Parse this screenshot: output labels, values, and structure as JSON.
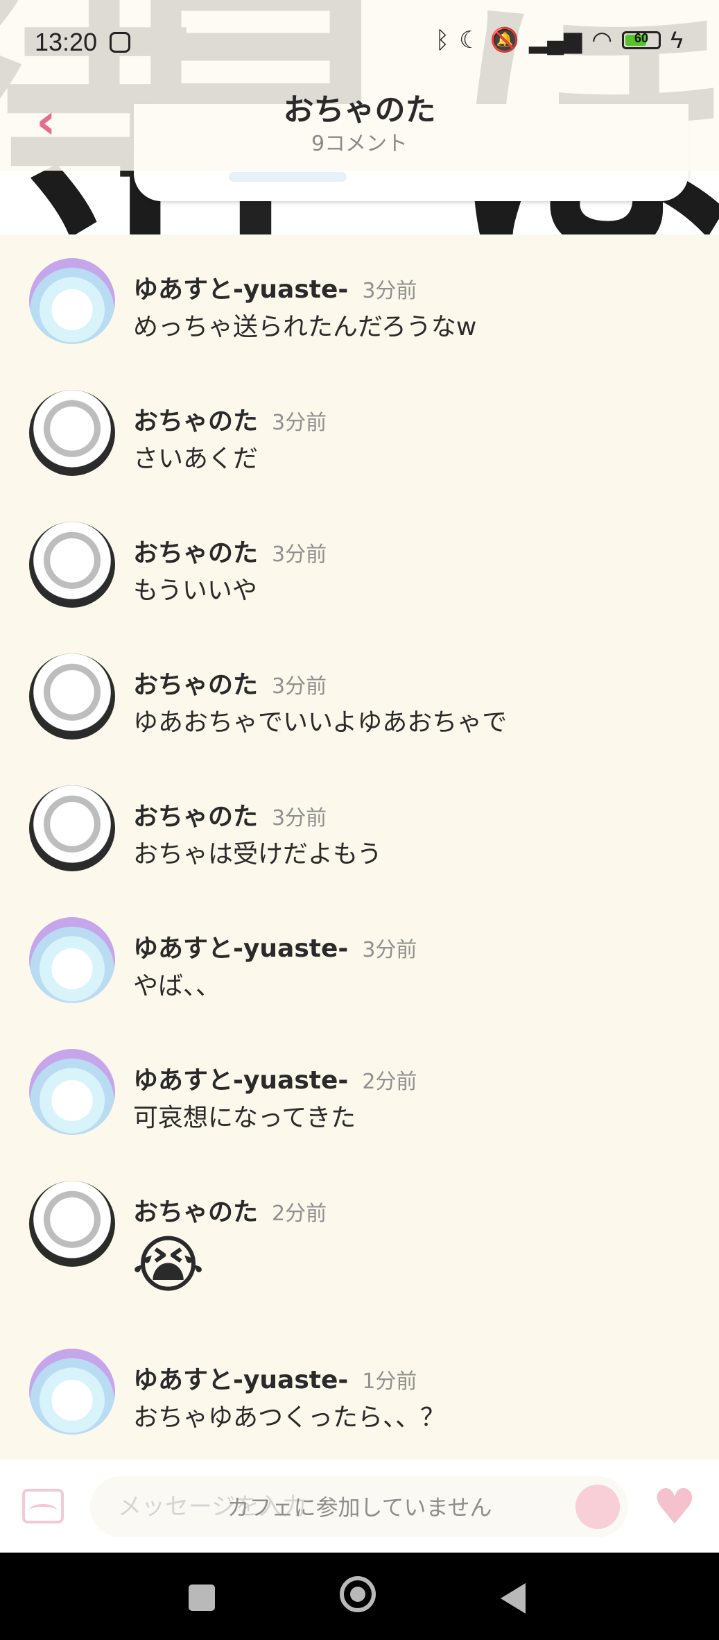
{
  "status_bar": {
    "time": "13:20",
    "left_icon": "mi-icon",
    "right_icons": [
      "bluetooth-icon",
      "moon-icon",
      "mute-icon",
      "signal-icon",
      "wifi-icon",
      "battery-icon",
      "charging-icon"
    ],
    "battery_level": "60",
    "battery_percent": 60
  },
  "header": {
    "title": "おちゃのた",
    "subtitle": "9コメント",
    "back_icon": "chevron-left-icon",
    "accent_color": "#e86a8e"
  },
  "banner": {
    "chars": [
      "待",
      "早",
      "ほ"
    ]
  },
  "comments": [
    {
      "author": "ゆあすと-yuaste-",
      "time": "3分前",
      "text": "めっちゃ送られたんだろうなw",
      "avatar": "witch-avatar"
    },
    {
      "author": "おちゃのた",
      "time": "3分前",
      "text": "さいあくだ",
      "avatar": "white-hair-avatar"
    },
    {
      "author": "おちゃのた",
      "time": "3分前",
      "text": "もういいや",
      "avatar": "white-hair-avatar"
    },
    {
      "author": "おちゃのた",
      "time": "3分前",
      "text": "ゆあおちゃでいいよゆあおちゃで",
      "avatar": "white-hair-avatar"
    },
    {
      "author": "おちゃのた",
      "time": "3分前",
      "text": "おちゃは受けだよもう",
      "avatar": "white-hair-avatar"
    },
    {
      "author": "ゆあすと-yuaste-",
      "time": "3分前",
      "text": "やば、、",
      "avatar": "witch-avatar"
    },
    {
      "author": "ゆあすと-yuaste-",
      "time": "2分前",
      "text": "可哀想になってきた",
      "avatar": "witch-avatar"
    },
    {
      "author": "おちゃのた",
      "time": "2分前",
      "text": "😭",
      "avatar": "white-hair-avatar"
    },
    {
      "author": "ゆあすと-yuaste-",
      "time": "1分前",
      "text": "おちゃゆあつくったら、、？",
      "avatar": "witch-avatar"
    }
  ],
  "bottom_bar": {
    "input_placeholder": "メッセージを入力",
    "join_notice": "カフェに参加していません",
    "image_icon": "image-icon",
    "sticker_icon": "sticker-icon",
    "like_icon": "heart-icon"
  },
  "nav_bar": {
    "icons": [
      "recents-square-icon",
      "home-circle-icon",
      "back-triangle-icon"
    ]
  }
}
